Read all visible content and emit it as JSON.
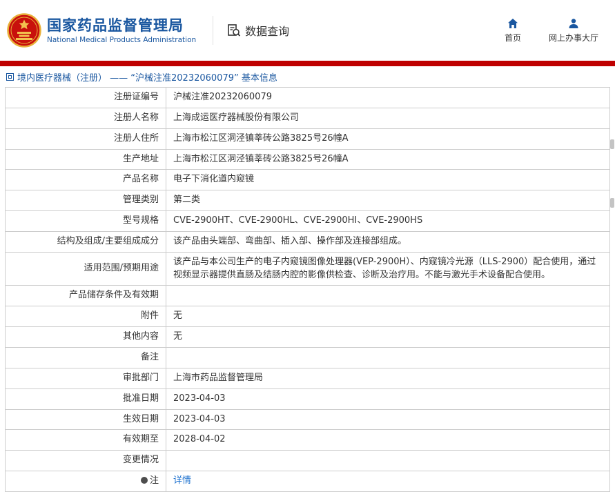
{
  "header": {
    "org_cn": "国家药品监督管理局",
    "org_en": "National Medical Products Administration",
    "section": "数据查询",
    "nav": [
      {
        "label": "首页",
        "icon": "home-icon"
      },
      {
        "label": "网上办事大厅",
        "icon": "user-icon"
      }
    ]
  },
  "breadcrumb": "境内医疗器械（注册） ——  “沪械注准20232060079”  基本信息",
  "table": {
    "rows": [
      {
        "label": "注册证编号",
        "value": "沪械注准20232060079"
      },
      {
        "label": "注册人名称",
        "value": "上海成运医疗器械股份有限公司"
      },
      {
        "label": "注册人住所",
        "value": "上海市松江区洞泾镇莘砖公路3825号26幢A"
      },
      {
        "label": "生产地址",
        "value": "上海市松江区洞泾镇莘砖公路3825号26幢A"
      },
      {
        "label": "产品名称",
        "value": "电子下消化道内窥镜"
      },
      {
        "label": "管理类别",
        "value": "第二类"
      },
      {
        "label": "型号规格",
        "value": "CVE-2900HT、CVE-2900HL、CVE-2900HI、CVE-2900HS"
      },
      {
        "label": "结构及组成/主要组成成分",
        "value": "该产品由头端部、弯曲部、插入部、操作部及连接部组成。"
      },
      {
        "label": "适用范围/预期用途",
        "value": "该产品与本公司生产的电子内窥镜图像处理器(VEP-2900H）、内窥镜冷光源（LLS-2900）配合使用，通过视频显示器提供直肠及结肠内腔的影像供检查、诊断及治疗用。不能与激光手术设备配合使用。"
      },
      {
        "label": "产品储存条件及有效期",
        "value": ""
      },
      {
        "label": "附件",
        "value": "无"
      },
      {
        "label": "其他内容",
        "value": "无"
      },
      {
        "label": "备注",
        "value": ""
      },
      {
        "label": "审批部门",
        "value": "上海市药品监督管理局"
      },
      {
        "label": "批准日期",
        "value": "2023-04-03"
      },
      {
        "label": "生效日期",
        "value": "2023-04-03"
      },
      {
        "label": "有效期至",
        "value": "2028-04-02"
      },
      {
        "label": "变更情况",
        "value": ""
      },
      {
        "label": "注",
        "value": "详情",
        "link": true,
        "label_icon": "note-icon"
      }
    ]
  },
  "colors": {
    "brand_blue": "#1a57a0",
    "red_bar": "#bf0000",
    "link_blue": "#1a6fce",
    "border_gray": "#cccccc"
  }
}
